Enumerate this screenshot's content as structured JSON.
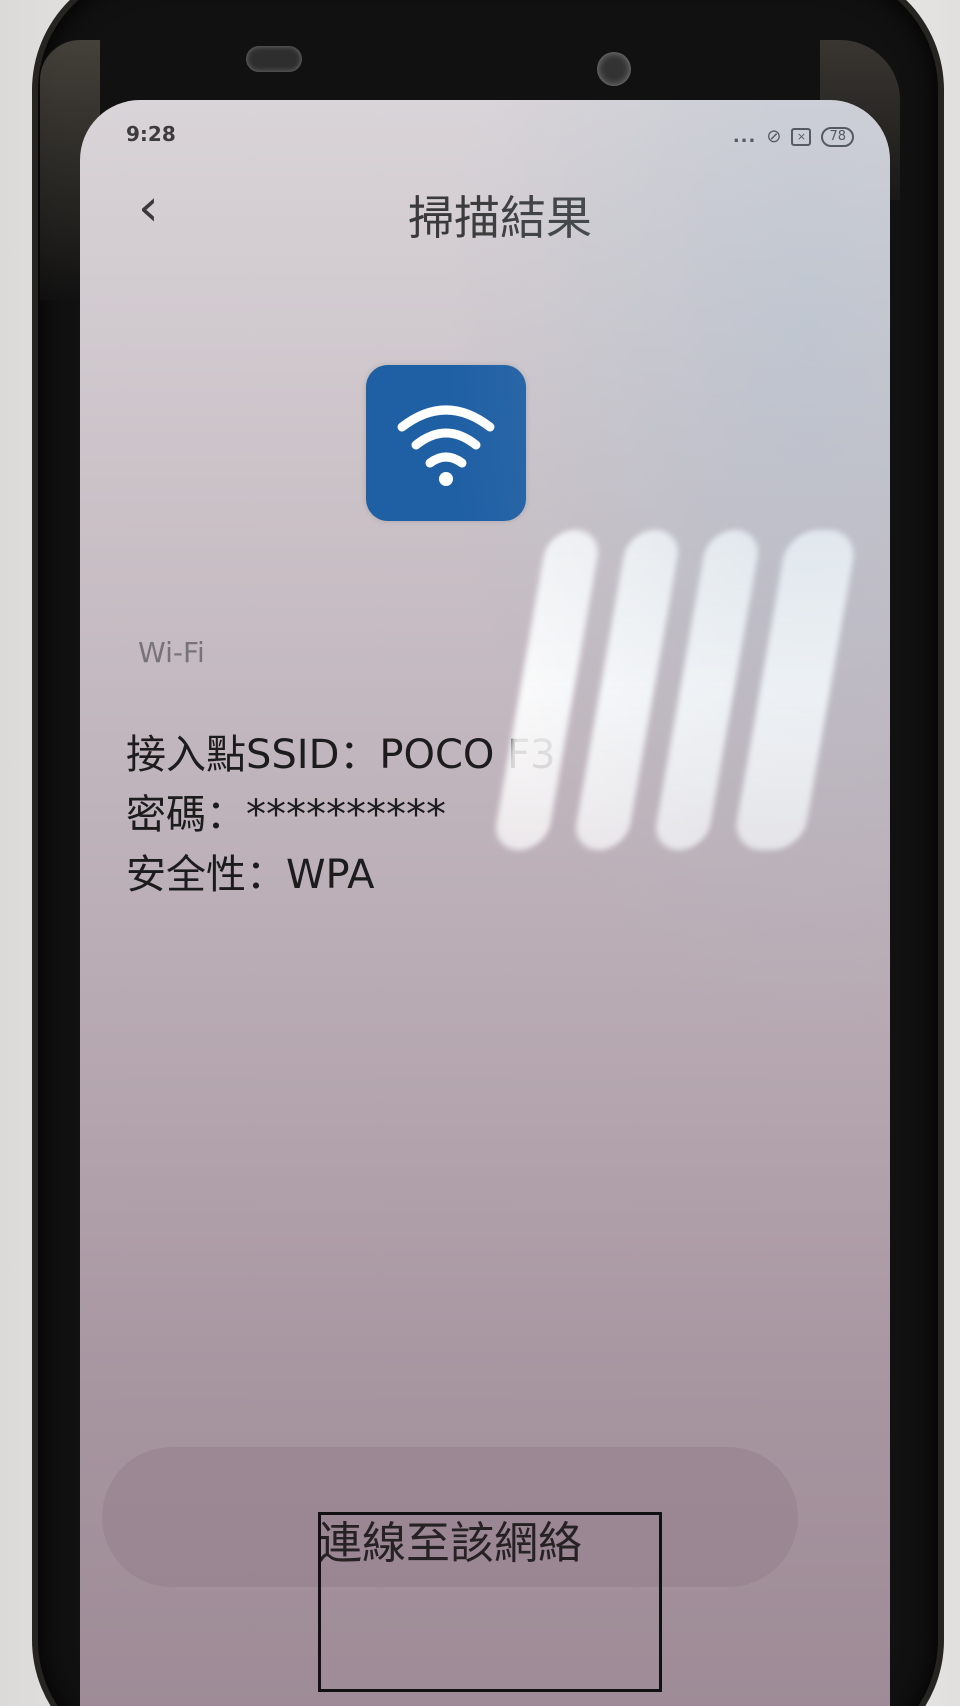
{
  "status_bar": {
    "time": "9:28",
    "signal_text": "...",
    "battery": "78"
  },
  "header": {
    "back_glyph": "‹",
    "title": "掃描結果"
  },
  "wifi_icon": {
    "name": "wifi-icon",
    "tile_color": "#1f5fa4"
  },
  "details": {
    "section_label": "Wi-Fi",
    "ssid": "接入點SSID：POCO F3",
    "password": "密碼：**********",
    "security": "安全性：WPA"
  },
  "actions": {
    "connect_label": "連線至該網絡"
  }
}
